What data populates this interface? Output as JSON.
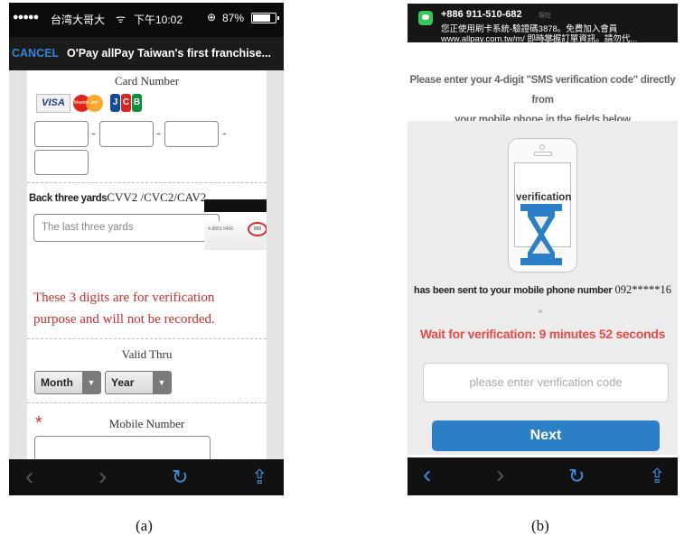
{
  "panel_a": {
    "status": {
      "signal": "●●●●●",
      "carrier": "台湾大哥大",
      "wifi": "ᯤ",
      "time": "下午10:02",
      "lock": "⊕",
      "battery": "87%",
      "battery_level": 0.87
    },
    "nav": {
      "cancel_label": "CANCEL",
      "title": "O'Pay allPay Taiwan's first franchise..."
    },
    "card_number_label": "Card Number",
    "card_logos": {
      "visa": "VISA",
      "mastercard": "MasterCard",
      "jcb": [
        "J",
        "C",
        "B"
      ]
    },
    "card_dash": "-",
    "cvv": {
      "label_bold": "Back three yards",
      "label_rest": "CVV2 /CVC2/CAV2",
      "placeholder": "The last three yards",
      "card_digits": "4-9853 5456",
      "card_circled": "999"
    },
    "verify_note": "These 3 digits are for verification purpose and will not be recorded.",
    "valid_thru_label": "Valid Thru",
    "month_select": "Month",
    "year_select": "Year",
    "required_mark": "*",
    "mobile_label": "Mobile Number",
    "toolbar": {
      "back": "‹",
      "forward": "›",
      "reload": "↻",
      "share": "⇪"
    },
    "caption": "(a)"
  },
  "panel_b": {
    "notification": {
      "sender": "+886 911-510-682",
      "when": "現在",
      "line1": "您正使用刷卡系統-驗證碼3878。免費加入會員",
      "line2": "www.allpay.com.tw/m/ 即時掌握訂單資訊。請勿代..."
    },
    "instruction_lines": [
      "Please enter your 4-digit \"SMS verification code\" directly from",
      "your mobile phone in the fields below"
    ],
    "phone_word": "verification",
    "sent_bold": "has been sent to your mobile phone number",
    "sent_number": "092*****16",
    "sent_period": "。",
    "wait_text": "Wait for verification: 9 minutes 52 seconds",
    "code_placeholder": "please enter verification code",
    "next_label": "Next",
    "toolbar": {
      "back": "‹",
      "forward": "›",
      "reload": "↻",
      "share": "⇪"
    },
    "caption": "(b)"
  },
  "colors": {
    "accent_blue": "#2b7fc7",
    "warning_red": "#c9302c",
    "wait_red": "#e44c4c",
    "hourglass": "#2b7fc7"
  }
}
